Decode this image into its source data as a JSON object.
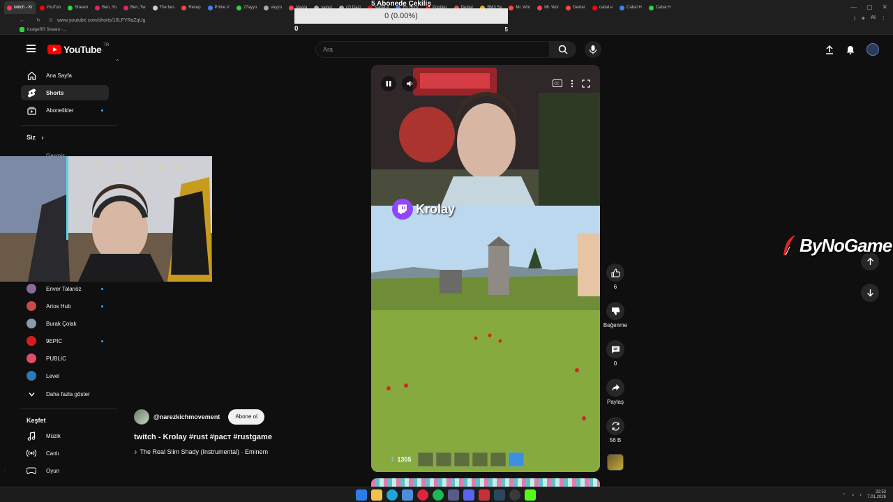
{
  "browser": {
    "tabs": [
      {
        "label": "twitch - Kr",
        "active": true,
        "color": "#ff3b5c"
      },
      {
        "label": "YouTub",
        "color": "#ff0000"
      },
      {
        "label": "Stream",
        "color": "#2bd63c"
      },
      {
        "label": "Ben, Yo",
        "color": "#e0245e"
      },
      {
        "label": "Ben, Tw",
        "color": "#e0245e"
      },
      {
        "label": "The bes",
        "color": "#cccccc"
      },
      {
        "label": "Recep",
        "color": "#ff4444"
      },
      {
        "label": "Prime V",
        "color": "#3b82f6"
      },
      {
        "label": "27ayyo",
        "color": "#2bd63c"
      },
      {
        "label": "vayyo",
        "color": "#aaaaaa"
      },
      {
        "label": "Vayya",
        "color": "#ff4444"
      },
      {
        "label": "vayyo",
        "color": "#aaaaaa"
      },
      {
        "label": "(2) Dazi",
        "color": "#aaaaaa"
      },
      {
        "label": "Kanal e",
        "color": "#ff0000"
      },
      {
        "label": "En Ucuz",
        "color": "#3b82f6"
      },
      {
        "label": "Popüler",
        "color": "#ff0000"
      },
      {
        "label": "Dexter",
        "color": "#ff4444"
      },
      {
        "label": "BM3 Sy",
        "color": "#ffaa00"
      },
      {
        "label": "Mr. Wor",
        "color": "#ff4444"
      },
      {
        "label": "Mr. Wor",
        "color": "#ff4444"
      },
      {
        "label": "Dexter",
        "color": "#ff4444"
      },
      {
        "label": "cabal e",
        "color": "#ff0000"
      },
      {
        "label": "Cabal H",
        "color": "#3b82f6"
      },
      {
        "label": "Cabal H",
        "color": "#2bd63c"
      }
    ],
    "url": "www.youtube.com/shorts/10LFYRaZqUg",
    "bookmark": "KralgeRR Stream -..."
  },
  "goal": {
    "title": "5 Abonede Çekiliş",
    "progress_text": "0 (0.00%)",
    "progress": 0,
    "min": "0",
    "max": "5"
  },
  "header": {
    "logo_text": "YouTube",
    "country": "TR",
    "search_placeholder": "Ara"
  },
  "sidebar": {
    "items": [
      {
        "label": "Ana Sayfa",
        "icon": "home-icon"
      },
      {
        "label": "Shorts",
        "icon": "shorts-icon",
        "active": true
      },
      {
        "label": "Abonelikler",
        "icon": "subscriptions-icon"
      }
    ],
    "you_title": "Siz",
    "partial_label": "Geçmiş",
    "channels": [
      {
        "label": "Enver Talanöz",
        "color": "#8a6a9a",
        "dot": true
      },
      {
        "label": "Artos Hub",
        "color": "#c84a4a",
        "dot": true
      },
      {
        "label": "Burak Çolak",
        "color": "#8a9aa8",
        "dot": false
      },
      {
        "label": "9EPIC",
        "color": "#d81c1c",
        "dot": true
      },
      {
        "label": "PUBLIC",
        "color": "#e04c6a",
        "dot": false
      },
      {
        "label": "Level",
        "color": "#2a7ab8",
        "dot": false
      }
    ],
    "show_more": "Daha fazla göster",
    "explore_title": "Keşfet",
    "explore": [
      {
        "label": "Müzik",
        "icon": "music-icon"
      },
      {
        "label": "Canlı",
        "icon": "live-icon"
      },
      {
        "label": "Oyun",
        "icon": "gaming-icon"
      }
    ]
  },
  "player": {
    "streamer": "Krolay",
    "hud_value": "1305"
  },
  "actions": {
    "likes": "6",
    "dislike_label": "Beğenme",
    "comments": "0",
    "share_label": "Paylaş",
    "remix_count": "56 B"
  },
  "watermark": "ByNoGame",
  "video": {
    "channel": "@narezkichmovement",
    "subscribe_label": "Abone ol",
    "title": "twitch - Krolay #rust #раст #rustgame",
    "music": "The Real Slim Shady (Instrumental) · Eminem"
  },
  "taskbar": {
    "time": "22:53",
    "date": "7.01.2026",
    "lang": "AI"
  }
}
